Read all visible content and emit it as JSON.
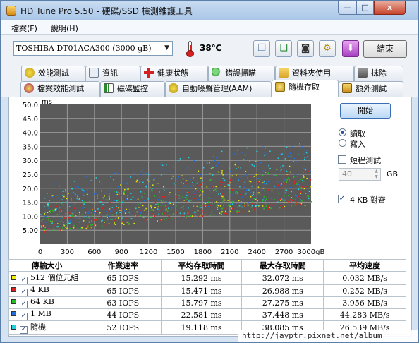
{
  "window": {
    "title": "HD Tune Pro 5.50 - 硬碟/SSD 檢測維護工具",
    "min_label": "—",
    "max_label": "□",
    "close_label": "x"
  },
  "menu": {
    "file": "檔案(F)",
    "help": "說明(H)"
  },
  "toolbar": {
    "drive": "TOSHIBA DT01ACA300 (3000 gB)",
    "temperature": "38℃",
    "exit_label": "結束",
    "icons": [
      "copy-icon",
      "copy-screen-icon",
      "camera-icon",
      "options-icon",
      "download-icon"
    ]
  },
  "tabs": {
    "row1": [
      "效能測試",
      "資訊",
      "健康狀態",
      "錯誤掃瞄",
      "資料夾使用",
      "抹除"
    ],
    "row2": [
      "檔案效能測試",
      "磁碟監控",
      "自動噪聲管理(AAM)",
      "隨機存取",
      "額外測試"
    ],
    "active": "隨機存取"
  },
  "side": {
    "start_label": "開始",
    "read_label": "讀取",
    "write_label": "寫入",
    "short_label": "短程測試",
    "gb_value": "40",
    "gb_unit": "GB",
    "align_label": "4 KB 對齊",
    "mode": "read",
    "short_checked": false,
    "align_checked": true
  },
  "chart_data": {
    "type": "scatter",
    "ylabel": "ms",
    "x_unit": "gB",
    "xlim": [
      0,
      3000
    ],
    "ylim": [
      0,
      50
    ],
    "x_ticks": [
      "0",
      "300",
      "600",
      "900",
      "1200",
      "1500",
      "1800",
      "2100",
      "2400",
      "2700",
      "3000gB"
    ],
    "y_ticks": [
      "5.00",
      "10.0",
      "15.0",
      "20.0",
      "25.0",
      "30.0",
      "35.0",
      "40.0",
      "45.0",
      "50.0"
    ],
    "grid": true,
    "series": [
      {
        "name": "512 個位元組",
        "color": "#e8e800",
        "avg_ms": 15.292,
        "max_ms": 32.072
      },
      {
        "name": "4 KB",
        "color": "#e02020",
        "avg_ms": 15.471,
        "max_ms": 26.988
      },
      {
        "name": "64 KB",
        "color": "#20c020",
        "avg_ms": 15.797,
        "max_ms": 27.275
      },
      {
        "name": "1 MB",
        "color": "#2070e0",
        "avg_ms": 22.581,
        "max_ms": 37.448
      },
      {
        "name": "隨機",
        "color": "#20d0e0",
        "avg_ms": 19.118,
        "max_ms": 38.085
      }
    ]
  },
  "results": {
    "headers": [
      "傳輸大小",
      "作業速率",
      "平均存取時間",
      "最大存取時間",
      "平均速度"
    ],
    "rows": [
      {
        "size": "512 個位元組",
        "color": "#f2f200",
        "iops": "65 IOPS",
        "avg": "15.292 ms",
        "max": "32.072 ms",
        "speed": "0.032 MB/s"
      },
      {
        "size": "4 KB",
        "color": "#e02020",
        "iops": "65 IOPS",
        "avg": "15.471 ms",
        "max": "26.988 ms",
        "speed": "0.252 MB/s"
      },
      {
        "size": "64 KB",
        "color": "#20c020",
        "iops": "63 IOPS",
        "avg": "15.797 ms",
        "max": "27.275 ms",
        "speed": "3.956 MB/s"
      },
      {
        "size": "1 MB",
        "color": "#2070e0",
        "iops": "44 IOPS",
        "avg": "22.581 ms",
        "max": "37.448 ms",
        "speed": "44.283 MB/s"
      },
      {
        "size": "隨機",
        "color": "#20d0e0",
        "iops": "52 IOPS",
        "avg": "19.118 ms",
        "max": "38.085 ms",
        "speed": "26.539 MB/s"
      }
    ]
  },
  "watermark": "http://jayptr.pixnet.net/album"
}
